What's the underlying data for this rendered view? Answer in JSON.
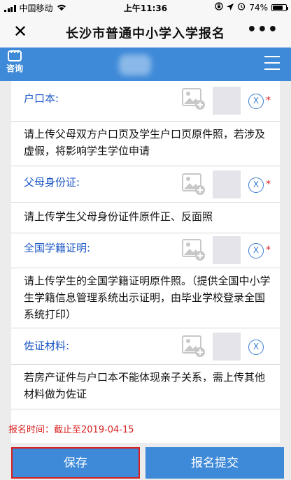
{
  "status": {
    "carrier": "中国移动",
    "time": "上午11:36",
    "battery": "74%"
  },
  "titlebar": {
    "title": "长沙市普通中小学入学报名",
    "close": "✕",
    "more": "•••"
  },
  "header": {
    "consult_label": "咨询"
  },
  "uploads": [
    {
      "label": "户口本:",
      "required": true,
      "remove": "X",
      "desc": "请上传父母双方户口页及学生户口页原件照，若涉及虚假，将影响学生学位申请"
    },
    {
      "label": "父母身份证:",
      "required": true,
      "remove": "X",
      "desc": "请上传学生父母身份证件原件正、反面照"
    },
    {
      "label": "全国学籍证明:",
      "required": true,
      "remove": "X",
      "desc": "请上传学生的全国学籍证明原件照。（提供全国中小学生学籍信息管理系统出示证明，由毕业学校登录全国系统打印）"
    },
    {
      "label": "佐证材料:",
      "required": false,
      "remove": "X",
      "desc": "若房产证件与户口本不能体现亲子关系，需上传其他材料做为佐证"
    }
  ],
  "required_mark": "*",
  "deadline": "报名时间：截止至2019-04-15",
  "buttons": {
    "save": "保存",
    "submit": "报名提交"
  }
}
